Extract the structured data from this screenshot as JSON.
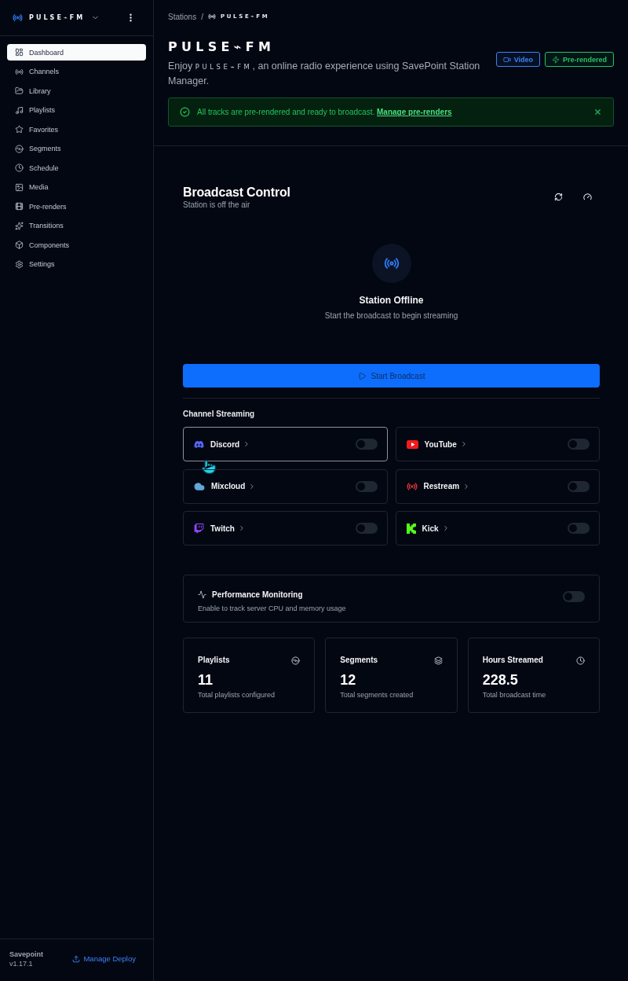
{
  "sidebar": {
    "brand": "PULSE⌁FM",
    "items": [
      {
        "label": "Dashboard",
        "selected": true
      },
      {
        "label": "Channels",
        "selected": false
      },
      {
        "label": "Library",
        "selected": false
      },
      {
        "label": "Playlists",
        "selected": false
      },
      {
        "label": "Favorites",
        "selected": false
      },
      {
        "label": "Segments",
        "selected": false
      },
      {
        "label": "Schedule",
        "selected": false
      },
      {
        "label": "Media",
        "selected": false
      },
      {
        "label": "Pre-renders",
        "selected": false
      },
      {
        "label": "Transitions",
        "selected": false
      },
      {
        "label": "Components",
        "selected": false
      },
      {
        "label": "Settings",
        "selected": false
      }
    ],
    "footer": {
      "app_name": "Savepoint",
      "version": "v1.17.1",
      "link": "Manage Deploy"
    }
  },
  "breadcrumb": {
    "items": [
      {
        "label": "Stations"
      },
      {
        "label": "PULSE⌁FM"
      }
    ],
    "separator": "/"
  },
  "station": {
    "title": "PULSE⌁FM",
    "description": {
      "before": "Enjoy",
      "brand": "PULSE⌁FM",
      "after": ", an online radio experience using SavePoint Station Manager."
    },
    "badges": [
      {
        "label": "Video",
        "color": "#3b82f6"
      },
      {
        "label": "Pre-rendered",
        "color": "#22c55e"
      }
    ]
  },
  "alert": {
    "message": "All tracks are pre-rendered and ready to broadcast.",
    "link": "Manage pre-renders"
  },
  "broadcast": {
    "title": "Broadcast Control",
    "subtitle": "Station is off the air",
    "status_title": "Station Offline",
    "status_message": "Start the broadcast to begin streaming",
    "button": "Start Broadcast"
  },
  "channels": {
    "title": "Channel Streaming",
    "items": [
      {
        "name": "Discord",
        "on": false,
        "hovered": true
      },
      {
        "name": "YouTube",
        "on": false,
        "hovered": false
      },
      {
        "name": "Mixcloud",
        "on": false,
        "hovered": false
      },
      {
        "name": "Restream",
        "on": false,
        "hovered": false
      },
      {
        "name": "Twitch",
        "on": false,
        "hovered": false
      },
      {
        "name": "Kick",
        "on": false,
        "hovered": false
      }
    ]
  },
  "performance": {
    "title": "Performance Monitoring",
    "description": "Enable to track server CPU and memory usage",
    "on": false
  },
  "stats": [
    {
      "label": "Playlists",
      "value": "11",
      "caption": "Total playlists configured"
    },
    {
      "label": "Segments",
      "value": "12",
      "caption": "Total segments created"
    },
    {
      "label": "Hours Streamed",
      "value": "228.5",
      "caption": "Total broadcast time"
    }
  ]
}
